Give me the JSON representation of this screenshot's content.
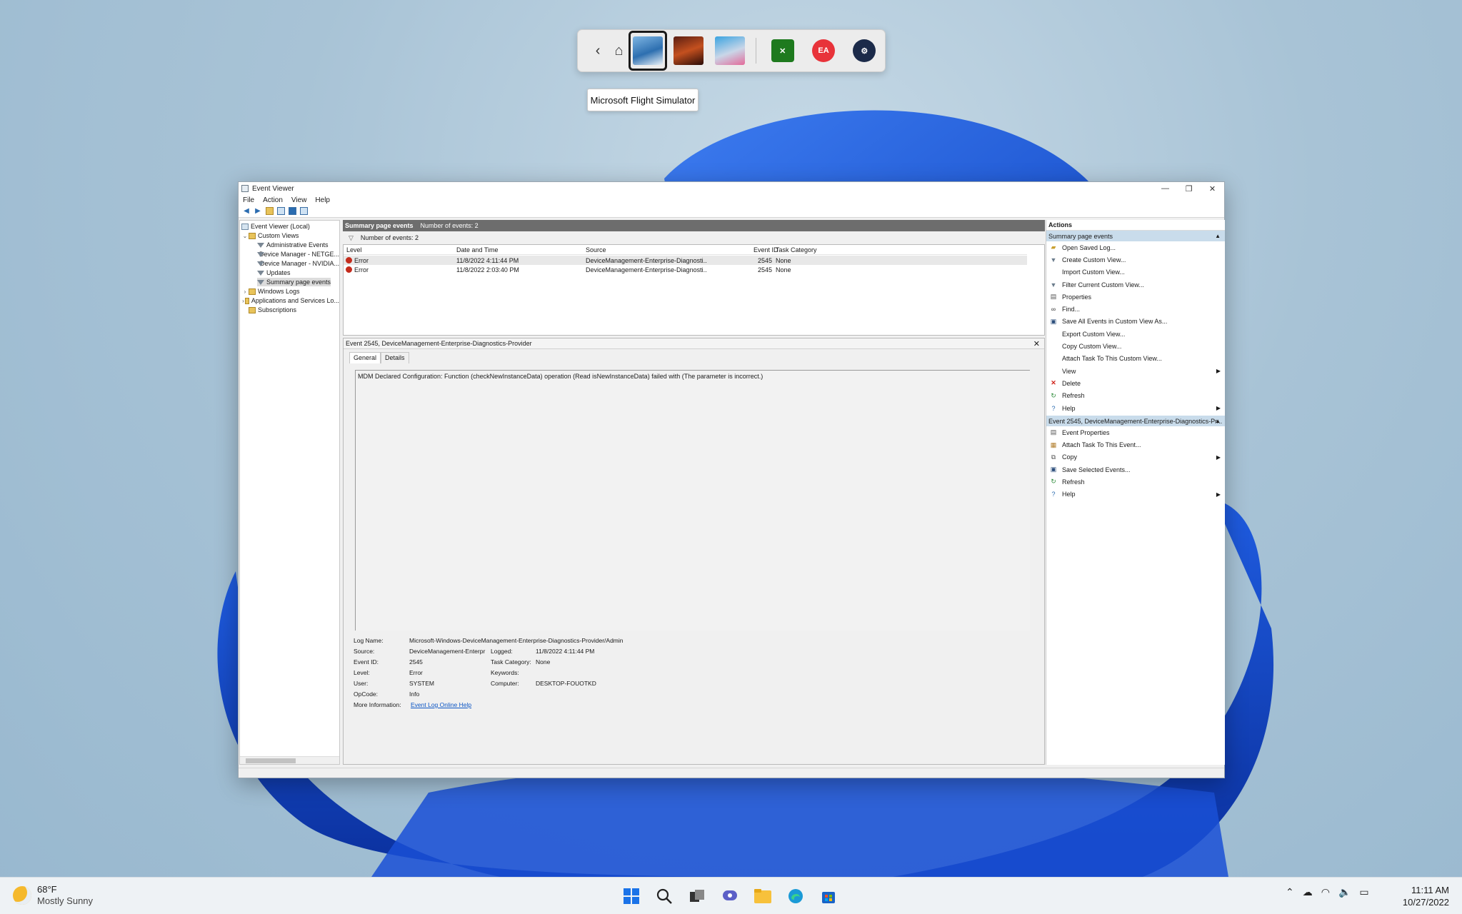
{
  "switcher": {
    "tooltip": "Microsoft Flight Simulator",
    "apps": [
      "flight-simulator",
      "game-2",
      "forza",
      "xbox",
      "ea",
      "steam"
    ],
    "ea_label": "EA"
  },
  "window": {
    "title": "Event Viewer",
    "menu": [
      "File",
      "Action",
      "View",
      "Help"
    ]
  },
  "tree": {
    "items": [
      {
        "label": "Event Viewer (Local)"
      },
      {
        "label": "Custom Views"
      },
      {
        "label": "Administrative Events"
      },
      {
        "label": "Device Manager - NETGE..."
      },
      {
        "label": "Device Manager - NVIDIA..."
      },
      {
        "label": "Updates"
      },
      {
        "label": "Summary page events"
      },
      {
        "label": "Windows Logs"
      },
      {
        "label": "Applications and Services Lo..."
      },
      {
        "label": "Subscriptions"
      }
    ]
  },
  "center": {
    "header_title": "Summary page events",
    "header_count": "Number of events: 2",
    "filter_count": "Number of events: 2",
    "columns": [
      "Level",
      "Date and Time",
      "Source",
      "Event ID",
      "Task Category"
    ],
    "rows": [
      {
        "level": "Error",
        "date": "11/8/2022 4:11:44 PM",
        "source": "DeviceManagement-Enterprise-Diagnosti...",
        "id": "2545",
        "task": "None"
      },
      {
        "level": "Error",
        "date": "11/8/2022 2:03:40 PM",
        "source": "DeviceManagement-Enterprise-Diagnosti...",
        "id": "2545",
        "task": "None"
      }
    ]
  },
  "detail": {
    "title": "Event 2545, DeviceManagement-Enterprise-Diagnostics-Provider",
    "tabs": [
      "General",
      "Details"
    ],
    "message": "MDM Declared Configuration: Function (checkNewInstanceData) operation (Read isNewInstanceData) failed with (The parameter is incorrect.)",
    "labels": {
      "log_name": "Log Name:",
      "source": "Source:",
      "event_id": "Event ID:",
      "level": "Level:",
      "user": "User:",
      "opcode": "OpCode:",
      "more_info": "More Information:",
      "logged": "Logged:",
      "task_category": "Task Category:",
      "keywords": "Keywords:",
      "computer": "Computer:"
    },
    "values": {
      "log_name": "Microsoft-Windows-DeviceManagement-Enterprise-Diagnostics-Provider/Admin",
      "source": "DeviceManagement-Enterpr",
      "event_id": "2545",
      "level": "Error",
      "user": "SYSTEM",
      "opcode": "Info",
      "more_info": "Event Log Online Help",
      "logged": "11/8/2022 4:11:44 PM",
      "task_category": "None",
      "keywords": "",
      "computer": "DESKTOP-FOUOTKD"
    }
  },
  "actions": {
    "header": "Actions",
    "section1": "Summary page events",
    "items1": [
      "Open Saved Log...",
      "Create Custom View...",
      "Import Custom View...",
      "Filter Current Custom View...",
      "Properties",
      "Find...",
      "Save All Events in Custom View As...",
      "Export Custom View...",
      "Copy Custom View...",
      "Attach Task To This Custom View...",
      "View",
      "Delete",
      "Refresh",
      "Help"
    ],
    "section2": "Event 2545, DeviceManagement-Enterprise-Diagnostics-Pr...",
    "items2": [
      "Event Properties",
      "Attach Task To This Event...",
      "Copy",
      "Save Selected Events...",
      "Refresh",
      "Help"
    ]
  },
  "taskbar": {
    "temperature": "68°F",
    "condition": "Mostly Sunny",
    "time": "11:11 AM",
    "date": "10/27/2022"
  },
  "colors": {
    "accent": "#0a5ce6",
    "error": "#c42b1c",
    "section_bg": "#c9dceb"
  }
}
